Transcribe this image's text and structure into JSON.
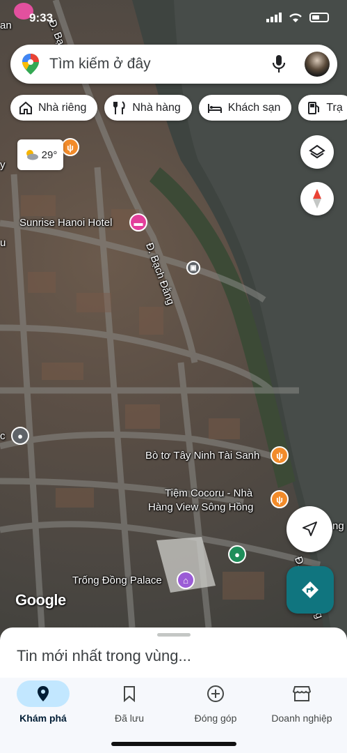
{
  "status_bar": {
    "time": "9:33"
  },
  "search": {
    "placeholder": "Tìm kiếm ở đây"
  },
  "chips": [
    {
      "label": "Nhà riêng",
      "icon": "home-icon"
    },
    {
      "label": "Nhà hàng",
      "icon": "restaurant-icon"
    },
    {
      "label": "Khách sạn",
      "icon": "hotel-icon"
    },
    {
      "label": "Trạ",
      "icon": "gas-station-icon"
    }
  ],
  "weather": {
    "temp": "29°",
    "icon": "partly-cloudy-icon"
  },
  "map_labels": {
    "street_top": "Đ. Bạch Đằng",
    "street_mid": "Đ. Bạch Đằng",
    "street_right": "Đ. Bạch Đằng",
    "hotel": "Sunrise Hanoi Hotel",
    "poi_bo": "Bò tơ Tây Ninh Tài Sanh",
    "poi_cocoru_1": "Tiệm Cocoru - Nhà",
    "poi_cocoru_2": "Hàng View Sông Hồng",
    "palace": "Trống Đồng Palace",
    "edge_an": "an",
    "edge_y": "y",
    "edge_u": "u",
    "edge_c": "c",
    "edge_ng": "ng",
    "brand": "Google"
  },
  "sheet": {
    "title": "Tin mới nhất trong vùng..."
  },
  "nav": [
    {
      "label": "Khám phá",
      "icon": "explore-pin-icon",
      "active": true
    },
    {
      "label": "Đã lưu",
      "icon": "bookmark-icon",
      "active": false
    },
    {
      "label": "Đóng góp",
      "icon": "add-circle-icon",
      "active": false
    },
    {
      "label": "Doanh nghiệp",
      "icon": "storefront-icon",
      "active": false
    }
  ],
  "colors": {
    "accent": "#10757f",
    "active_pill": "#c2e7ff",
    "food_pin": "#f28b2a",
    "hotel_pin": "#e23f9b"
  }
}
